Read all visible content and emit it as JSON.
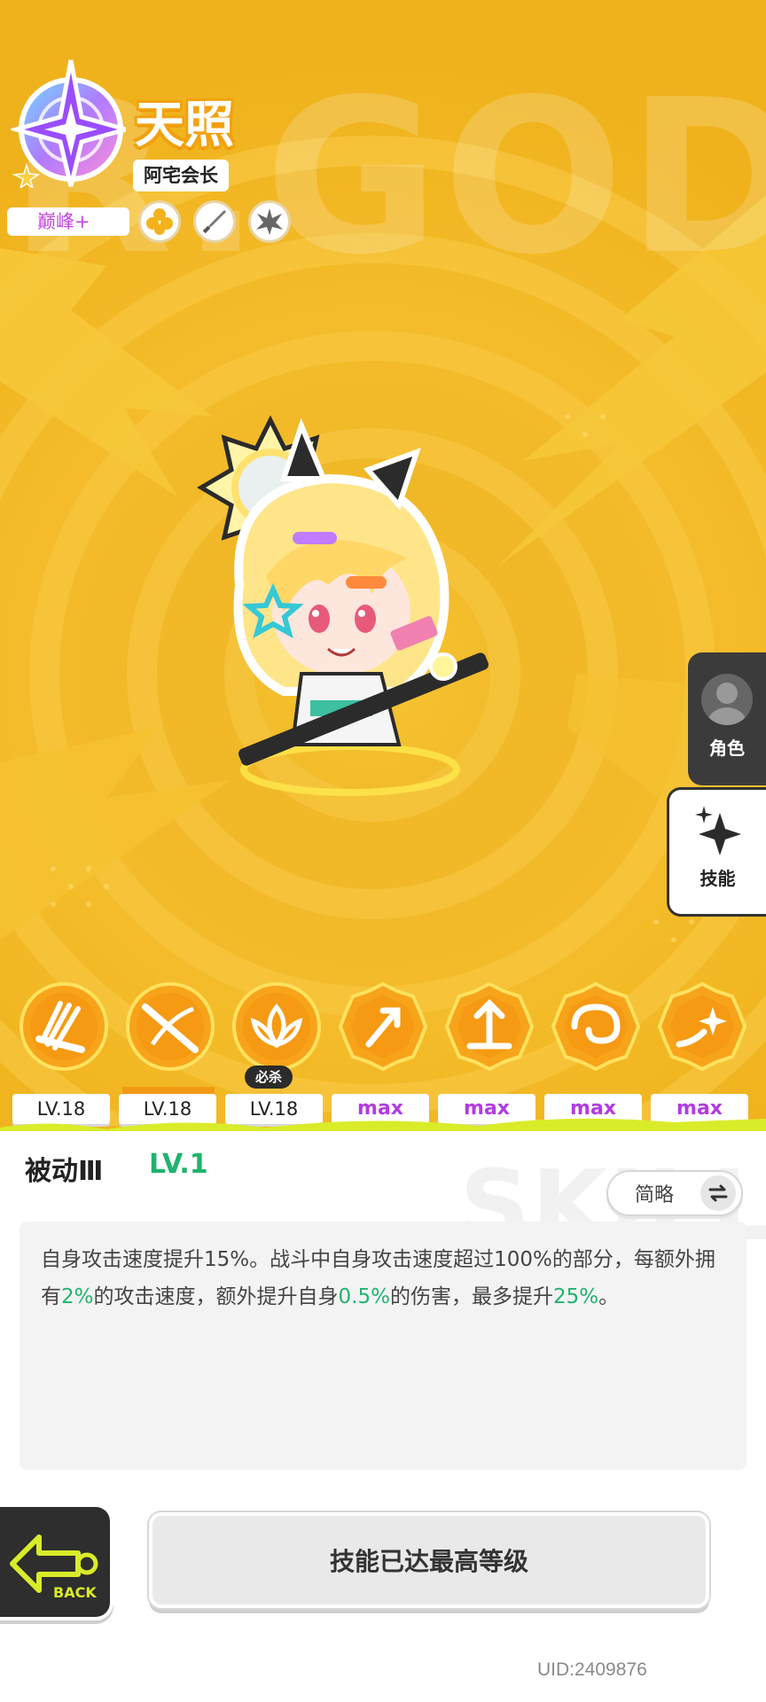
{
  "header": {
    "name": "天照",
    "title": "阿宅会长",
    "rank": "巅峰+",
    "traits": [
      "flower-icon",
      "sword-icon",
      "burst-icon"
    ]
  },
  "background": {
    "watermark": "R.GOD"
  },
  "side_tabs": [
    {
      "label": "角色",
      "icon": "avatar-icon",
      "active": false
    },
    {
      "label": "技能",
      "icon": "sparkle-icon",
      "active": true
    }
  ],
  "skills": [
    {
      "icon": "fan-strike-icon",
      "level": "LV.18",
      "max": false,
      "selected": false,
      "tag": ""
    },
    {
      "icon": "sword-slash-icon",
      "level": "LV.18",
      "max": false,
      "selected": true,
      "tag": ""
    },
    {
      "icon": "lotus-icon",
      "level": "LV.18",
      "max": false,
      "selected": false,
      "tag": "必杀"
    },
    {
      "icon": "arrow-burst-icon",
      "level": "max",
      "max": true,
      "selected": false,
      "tag": ""
    },
    {
      "icon": "arrow-up-icon",
      "level": "max",
      "max": true,
      "selected": false,
      "tag": ""
    },
    {
      "icon": "swirl-icon",
      "level": "max",
      "max": true,
      "selected": false,
      "tag": ""
    },
    {
      "icon": "comet-icon",
      "level": "max",
      "max": true,
      "selected": false,
      "tag": ""
    }
  ],
  "detail": {
    "skill_name": "被动Ⅲ",
    "skill_level": "LV.1",
    "toggle_label": "简略",
    "description_parts": [
      {
        "text": "自身攻击速度提升15%。战斗中自身攻击速度超过100%的部分，每额外拥有",
        "highlight": false
      },
      {
        "text": "2%",
        "highlight": true
      },
      {
        "text": "的攻击速度，额外提升自身",
        "highlight": false
      },
      {
        "text": "0.5%",
        "highlight": true
      },
      {
        "text": "的伤害，最多提升",
        "highlight": false
      },
      {
        "text": "25%",
        "highlight": true
      },
      {
        "text": "。",
        "highlight": false
      }
    ],
    "watermark": "SKILL"
  },
  "footer": {
    "back_label": "BACK",
    "action_label": "技能已达最高等级",
    "uid": "UID:2409876"
  },
  "colors": {
    "background": "#f0b51d",
    "accent_orange": "#f29a14",
    "max_purple": "#b23be3",
    "highlight_green": "#21b26e",
    "rank_pink": "#c347e0",
    "slime_green": "#d9ec2a"
  }
}
